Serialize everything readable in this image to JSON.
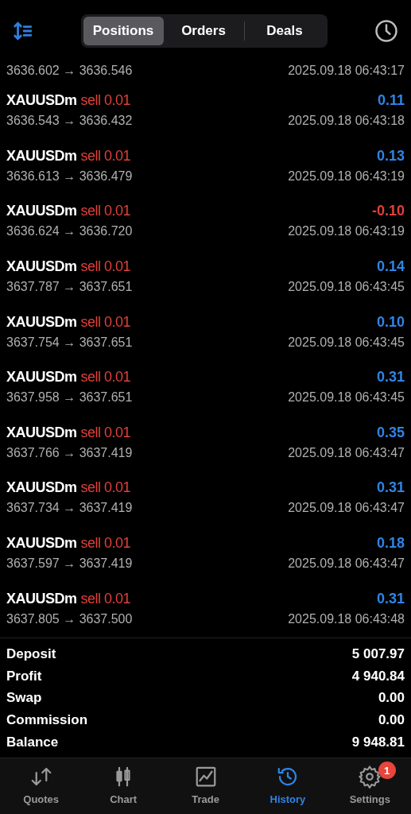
{
  "tabs": [
    {
      "label": "Positions",
      "selected": true
    },
    {
      "label": "Orders",
      "selected": false
    },
    {
      "label": "Deals",
      "selected": false
    }
  ],
  "partial_row": {
    "prices": "3636.602 → 3636.546",
    "time": "2025.09.18 06:43:17"
  },
  "deals": [
    {
      "symbol": "XAUUSDm",
      "side": "sell 0.01",
      "profit": "0.11",
      "loss": false,
      "prices": "3636.543 → 3636.432",
      "time": "2025.09.18 06:43:18"
    },
    {
      "symbol": "XAUUSDm",
      "side": "sell 0.01",
      "profit": "0.13",
      "loss": false,
      "prices": "3636.613 → 3636.479",
      "time": "2025.09.18 06:43:19"
    },
    {
      "symbol": "XAUUSDm",
      "side": "sell 0.01",
      "profit": "-0.10",
      "loss": true,
      "prices": "3636.624 → 3636.720",
      "time": "2025.09.18 06:43:19"
    },
    {
      "symbol": "XAUUSDm",
      "side": "sell 0.01",
      "profit": "0.14",
      "loss": false,
      "prices": "3637.787 → 3637.651",
      "time": "2025.09.18 06:43:45"
    },
    {
      "symbol": "XAUUSDm",
      "side": "sell 0.01",
      "profit": "0.10",
      "loss": false,
      "prices": "3637.754 → 3637.651",
      "time": "2025.09.18 06:43:45"
    },
    {
      "symbol": "XAUUSDm",
      "side": "sell 0.01",
      "profit": "0.31",
      "loss": false,
      "prices": "3637.958 → 3637.651",
      "time": "2025.09.18 06:43:45"
    },
    {
      "symbol": "XAUUSDm",
      "side": "sell 0.01",
      "profit": "0.35",
      "loss": false,
      "prices": "3637.766 → 3637.419",
      "time": "2025.09.18 06:43:47"
    },
    {
      "symbol": "XAUUSDm",
      "side": "sell 0.01",
      "profit": "0.31",
      "loss": false,
      "prices": "3637.734 → 3637.419",
      "time": "2025.09.18 06:43:47"
    },
    {
      "symbol": "XAUUSDm",
      "side": "sell 0.01",
      "profit": "0.18",
      "loss": false,
      "prices": "3637.597 → 3637.419",
      "time": "2025.09.18 06:43:47"
    },
    {
      "symbol": "XAUUSDm",
      "side": "sell 0.01",
      "profit": "0.31",
      "loss": false,
      "prices": "3637.805 → 3637.500",
      "time": "2025.09.18 06:43:48"
    }
  ],
  "summary": [
    {
      "label": "Deposit",
      "value": "5 007.97"
    },
    {
      "label": "Profit",
      "value": "4 940.84"
    },
    {
      "label": "Swap",
      "value": "0.00"
    },
    {
      "label": "Commission",
      "value": "0.00"
    },
    {
      "label": "Balance",
      "value": "9 948.81"
    }
  ],
  "nav": [
    {
      "kind": "quotes",
      "label": "Quotes",
      "selected": false
    },
    {
      "kind": "chart",
      "label": "Chart",
      "selected": false
    },
    {
      "kind": "trade",
      "label": "Trade",
      "selected": false
    },
    {
      "kind": "history",
      "label": "History",
      "selected": true
    },
    {
      "kind": "settings",
      "label": "Settings",
      "selected": false,
      "badge": "1"
    }
  ]
}
